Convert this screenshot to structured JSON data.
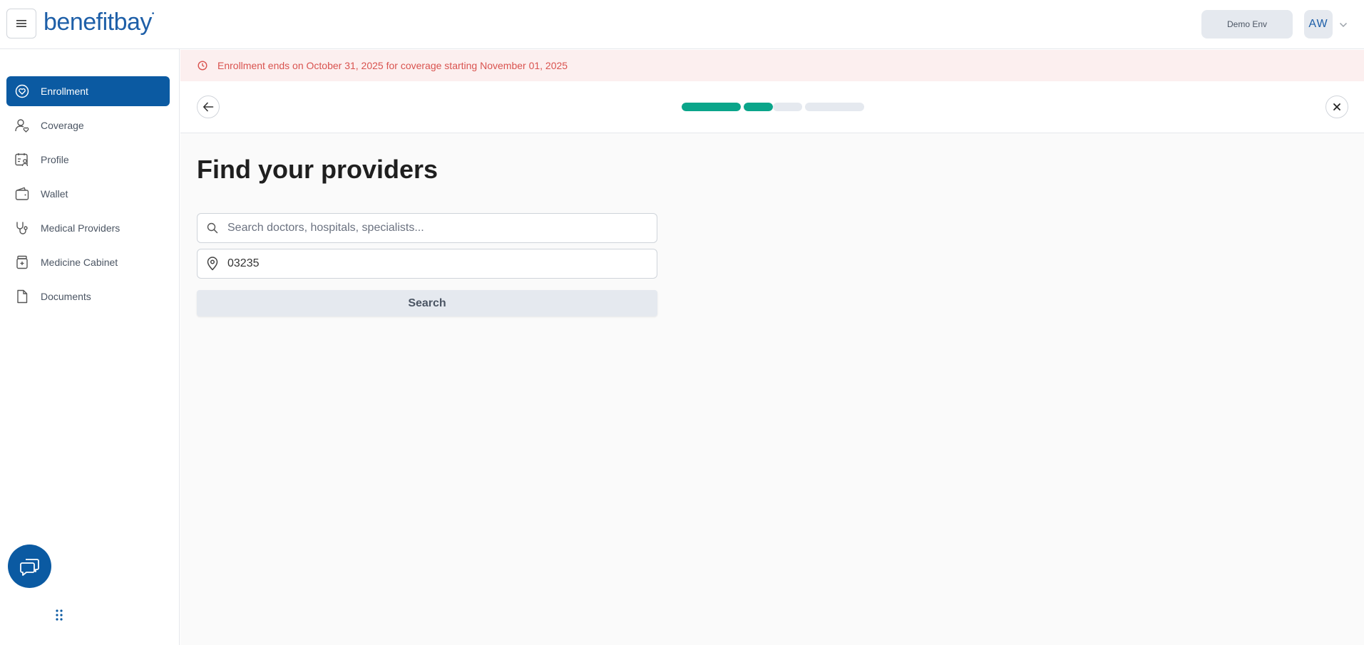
{
  "header": {
    "logo_text": "benefitbay",
    "env_label": "Demo Env",
    "avatar_initials": "AW"
  },
  "sidebar": {
    "items": [
      {
        "label": "Enrollment",
        "icon": "heart-shield-icon",
        "active": true
      },
      {
        "label": "Coverage",
        "icon": "user-heart-icon"
      },
      {
        "label": "Profile",
        "icon": "calendar-user-icon"
      },
      {
        "label": "Wallet",
        "icon": "wallet-icon"
      },
      {
        "label": "Medical Providers",
        "icon": "stethoscope-icon"
      },
      {
        "label": "Medicine Cabinet",
        "icon": "medicine-bottle-icon"
      },
      {
        "label": "Documents",
        "icon": "document-icon"
      }
    ]
  },
  "banner": {
    "text": "Enrollment ends on October 31, 2025 for coverage starting November 01, 2025",
    "icon": "clock-icon"
  },
  "progress": {
    "steps": [
      {
        "fill": 1.0
      },
      {
        "fill": 1.0
      },
      {
        "fill": 0.0
      },
      {
        "fill": 0.0
      }
    ]
  },
  "main": {
    "title": "Find your providers",
    "search": {
      "placeholder": "Search doctors, hospitals, specialists...",
      "value": ""
    },
    "location": {
      "value": "03235"
    },
    "search_button_label": "Search"
  },
  "colors": {
    "brand": "#0b5aa2",
    "progress": "#0aa58a",
    "banner_bg": "#fcefef",
    "banner_text": "#d9534f"
  }
}
